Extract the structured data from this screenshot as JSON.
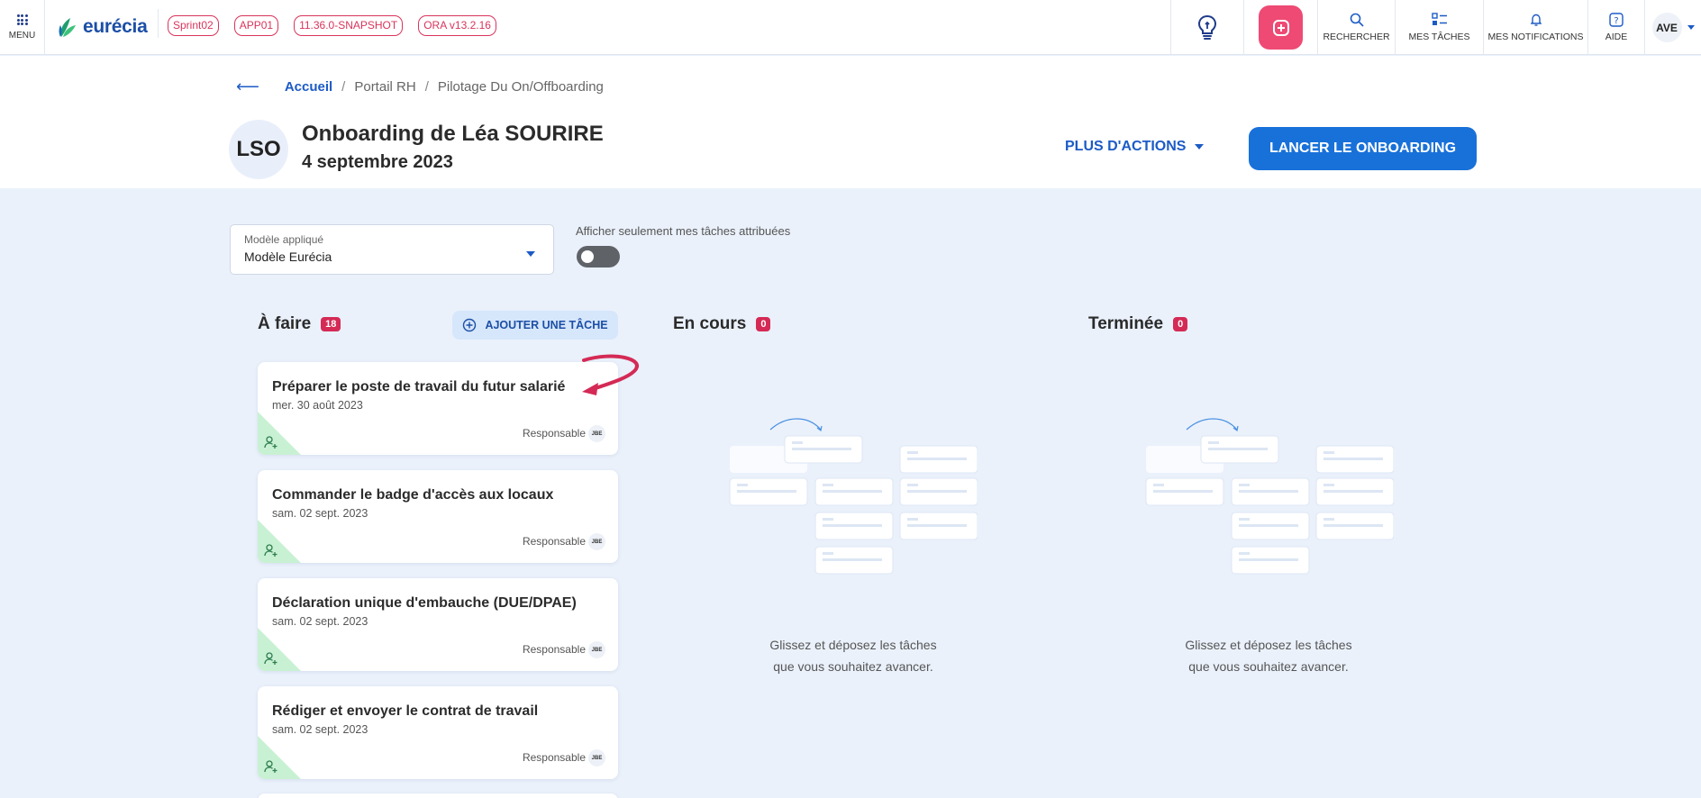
{
  "topbar": {
    "menu_label": "MENU",
    "logo_text": "eurécia",
    "env_tags": [
      "Sprint02",
      "APP01",
      "11.36.0-SNAPSHOT",
      "ORA v13.2.16"
    ],
    "search_label": "RECHERCHER",
    "tasks_label": "MES TÂCHES",
    "notifications_label": "MES NOTIFICATIONS",
    "help_label": "AIDE",
    "user_initials": "AVE"
  },
  "breadcrumb": {
    "home": "Accueil",
    "level2": "Portail RH",
    "level3": "Pilotage Du On/Offboarding"
  },
  "header": {
    "avatar_initials": "LSO",
    "title": "Onboarding de Léa SOURIRE",
    "date": "4 septembre 2023",
    "more_actions": "PLUS D'ACTIONS",
    "launch_button": "LANCER LE ONBOARDING"
  },
  "filters": {
    "model_label": "Modèle appliqué",
    "model_value": "Modèle Eurécia",
    "toggle_label": "Afficher seulement mes tâches attribuées",
    "toggle_on": false
  },
  "columns": {
    "todo": {
      "name": "À faire",
      "count": "18",
      "add_button": "AJOUTER UNE TÂCHE"
    },
    "in_progress": {
      "name": "En cours",
      "count": "0",
      "empty_line1": "Glissez et déposez les tâches",
      "empty_line2": "que vous souhaitez avancer."
    },
    "done": {
      "name": "Terminée",
      "count": "0",
      "empty_line1": "Glissez et déposez les tâches",
      "empty_line2": "que vous souhaitez avancer."
    }
  },
  "tasks": [
    {
      "title": "Préparer le poste de travail du futur salarié",
      "date": "mer. 30 août 2023",
      "role": "Responsable",
      "assignee": "JBE"
    },
    {
      "title": "Commander le badge d'accès aux locaux",
      "date": "sam. 02 sept. 2023",
      "role": "Responsable",
      "assignee": "JBE"
    },
    {
      "title": "Déclaration unique d'embauche (DUE/DPAE)",
      "date": "sam. 02 sept. 2023",
      "role": "Responsable",
      "assignee": "JBE"
    },
    {
      "title": "Rédiger et envoyer le contrat de travail",
      "date": "sam. 02 sept. 2023",
      "role": "Responsable",
      "assignee": "JBE"
    }
  ],
  "colors": {
    "primary": "#1871d9",
    "accent_pink": "#ee4a74",
    "badge": "#d42a55",
    "background": "#eaf1fb",
    "corner_green": "#c8f1d3"
  },
  "icons": [
    "menu-icon",
    "logo-leaf-icon",
    "lightbulb-icon",
    "plus-square-icon",
    "search-icon",
    "tasks-icon",
    "bell-icon",
    "help-icon",
    "chevron-down-icon",
    "back-arrow-icon",
    "add-circle-icon",
    "add-user-icon",
    "curved-arrow-icon"
  ]
}
